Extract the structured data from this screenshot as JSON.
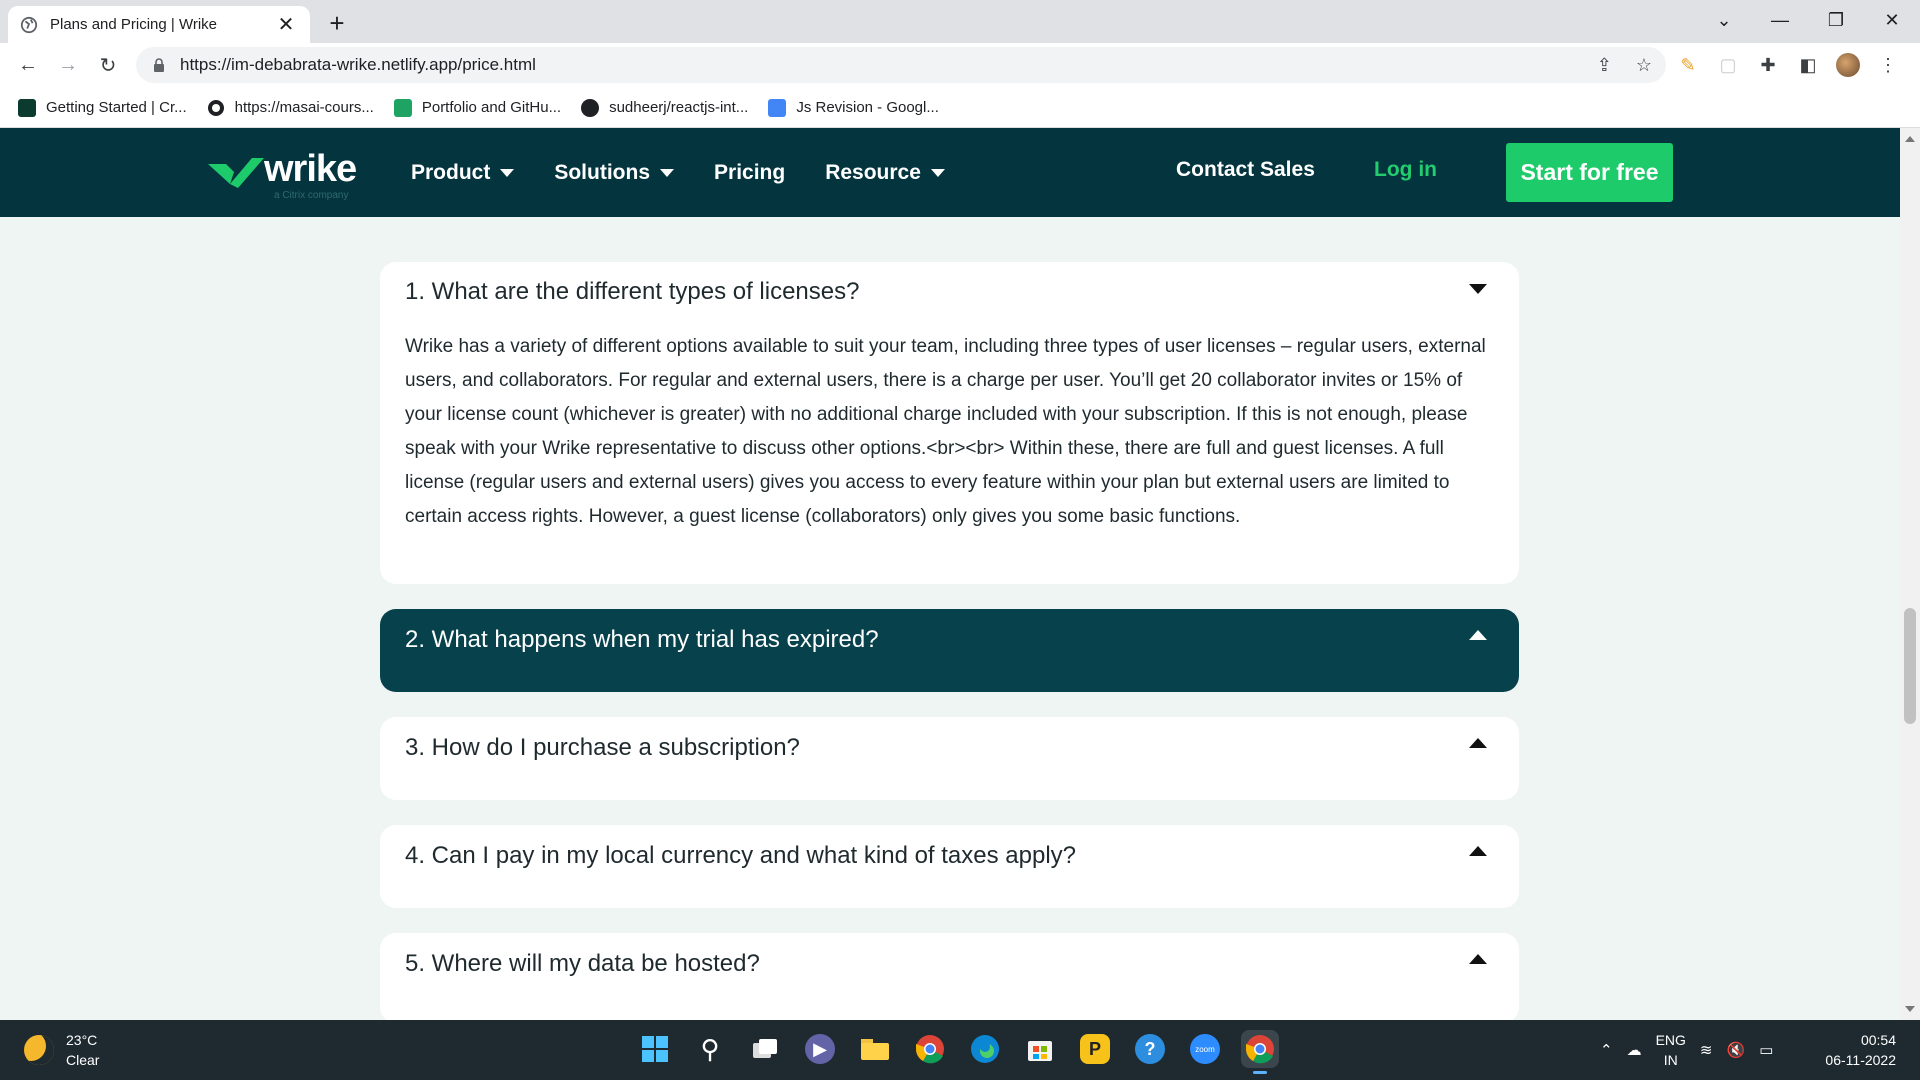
{
  "browser": {
    "tab_title": "Plans and Pricing | Wrike",
    "url": "https://im-debabrata-wrike.netlify.app/price.html",
    "bookmarks": [
      {
        "label": "Getting Started | Cr...",
        "icon": "react-icon"
      },
      {
        "label": "https://masai-cours...",
        "icon": "globe-icon"
      },
      {
        "label": "Portfolio and GitHu...",
        "icon": "sheets-icon"
      },
      {
        "label": "sudheerj/reactjs-int...",
        "icon": "github-icon"
      },
      {
        "label": "Js Revision - Googl...",
        "icon": "docs-icon"
      }
    ]
  },
  "header": {
    "logo_text": "wrike",
    "logo_subtext": "a Citrix company",
    "menu": [
      {
        "label": "Product",
        "has_caret": true
      },
      {
        "label": "Solutions",
        "has_caret": true
      },
      {
        "label": "Pricing",
        "has_caret": false
      },
      {
        "label": "Resource",
        "has_caret": true
      }
    ],
    "contact_sales": "Contact Sales",
    "login": "Log in",
    "cta": "Start for free"
  },
  "faq": [
    {
      "question": "1. What are the different types of licenses?",
      "answer": "Wrike has a variety of different options available to suit your team, including three types of user licenses – regular users, external users, and collaborators. For regular and external users, there is a charge per user. You’ll get 20 collaborator invites or 15% of your license count (whichever is greater) with no additional charge included with your subscription. If this is not enough, please speak with your Wrike representative to discuss other options.<br><br> Within these, there are full and guest licenses. A full license (regular users and external users) gives you access to every feature within your plan but external users are limited to certain access rights. However, a guest license (collaborators) only gives you some basic functions.",
      "expanded": true
    },
    {
      "question": "2. What happens when my trial has expired?",
      "highlighted": true
    },
    {
      "question": "3. How do I purchase a subscription?"
    },
    {
      "question": "4. Can I pay in my local currency and what kind of taxes apply?"
    },
    {
      "question": "5. Where will my data be hosted?"
    }
  ],
  "taskbar": {
    "temperature": "23°C",
    "condition": "Clear",
    "lang_top": "ENG",
    "lang_bottom": "IN",
    "time": "00:54",
    "date": "06-11-2022"
  },
  "colors": {
    "header_bg": "#04353f",
    "accent_green": "#1ecb6b",
    "active_faq_bg": "#06414c",
    "page_bg": "#eef5f2"
  }
}
